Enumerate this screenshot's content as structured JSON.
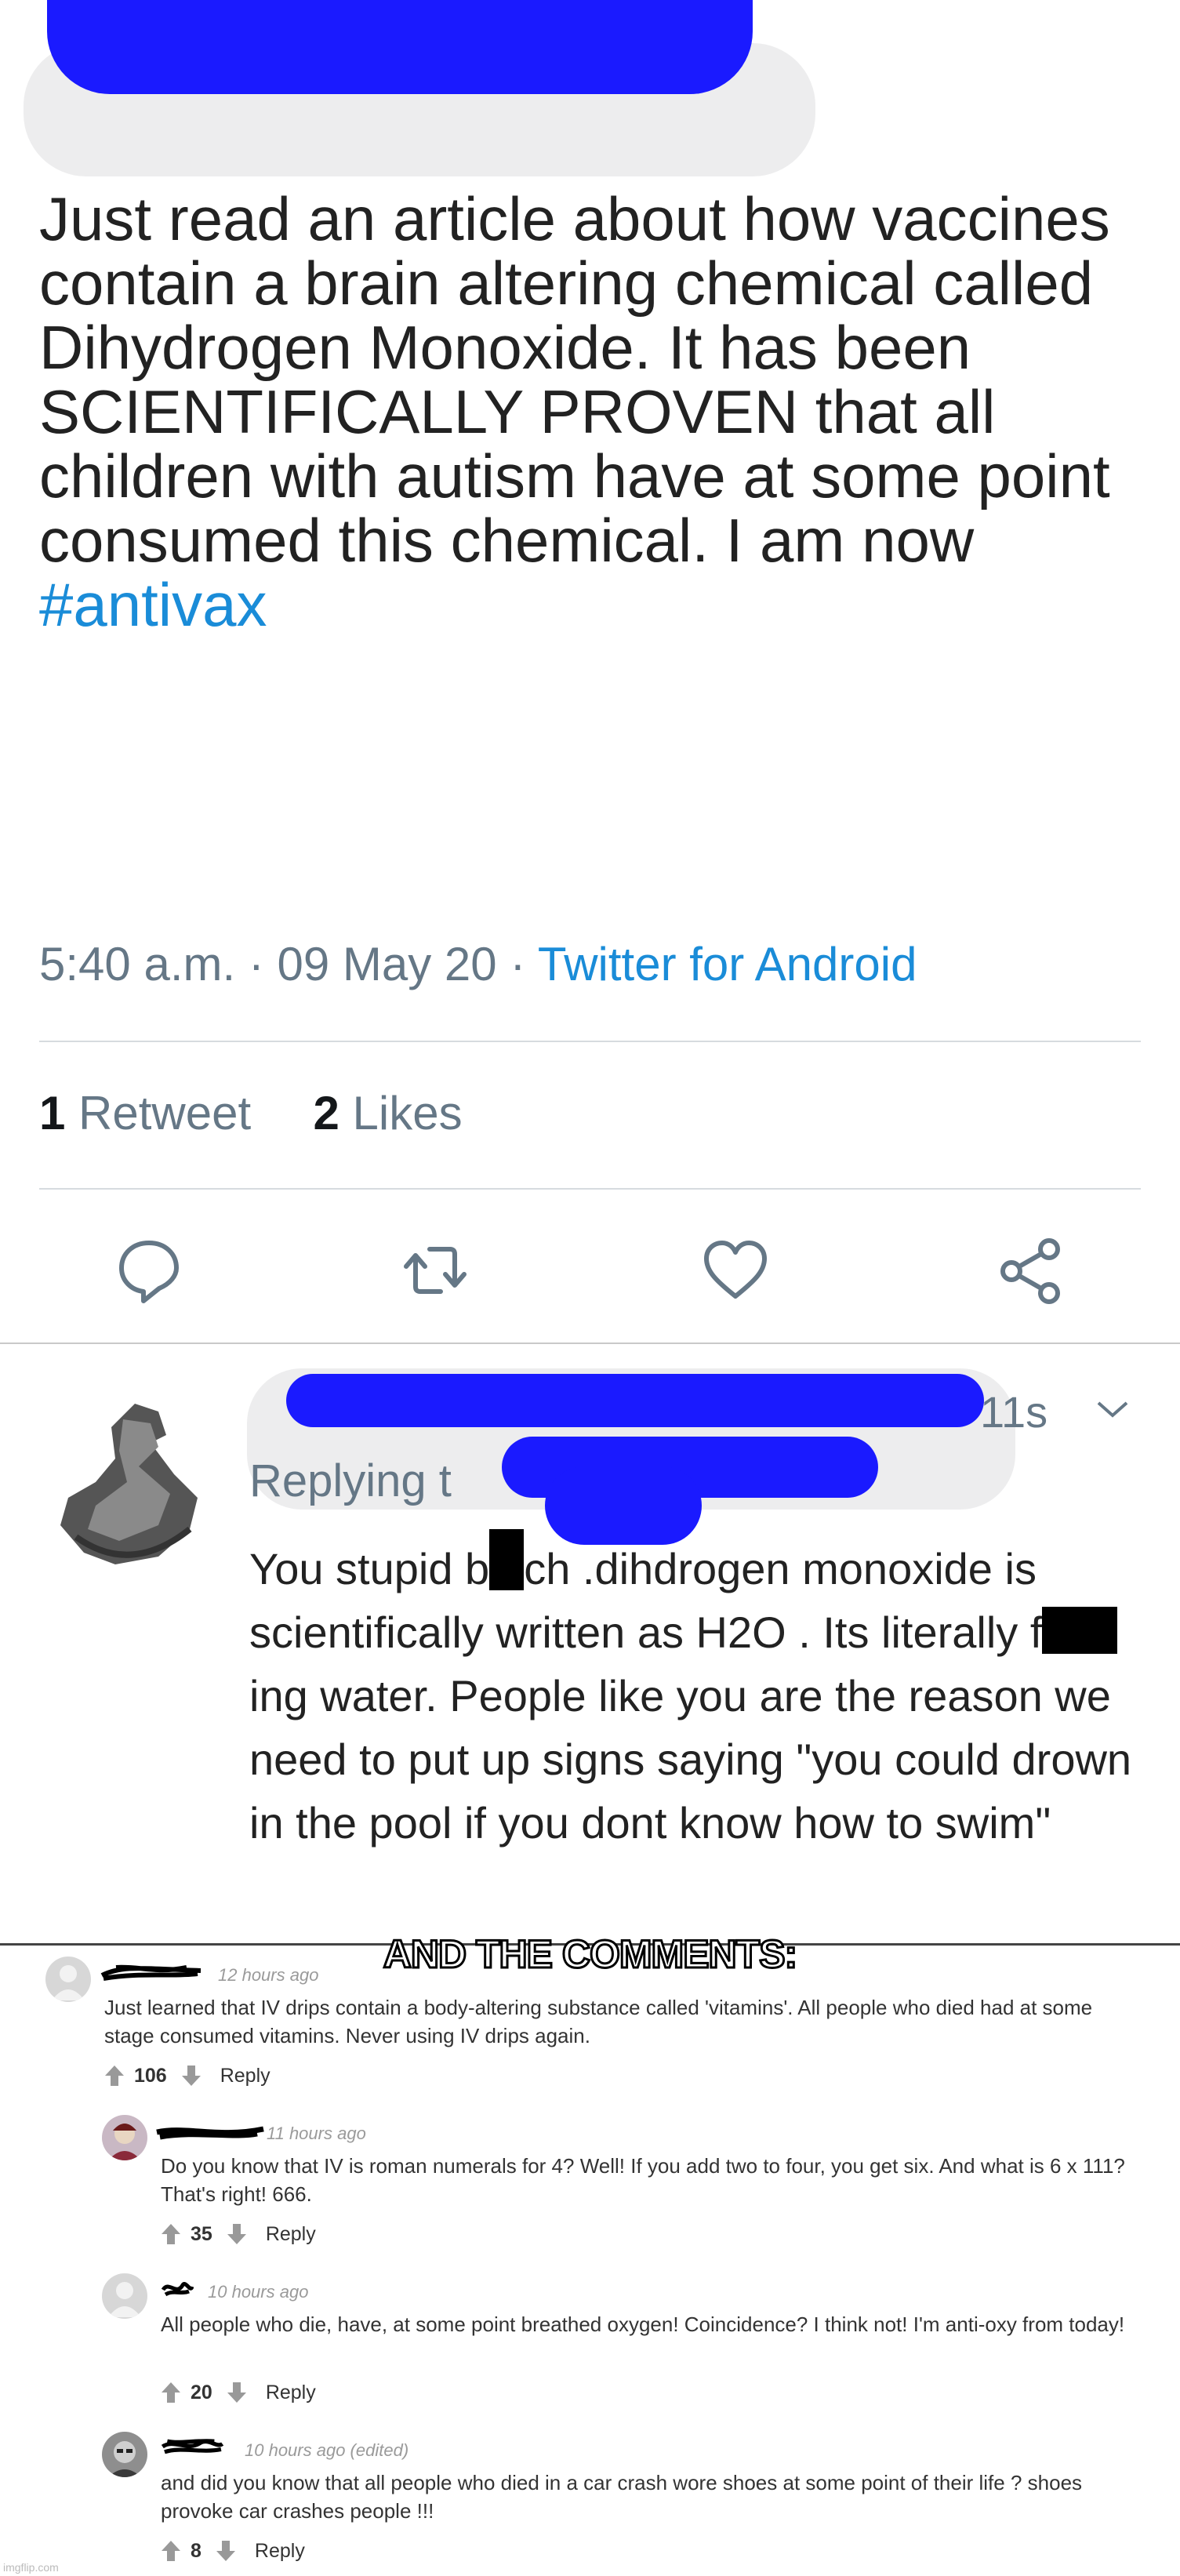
{
  "tweet": {
    "text": "Just read an article about how vaccines contain a brain altering chemical called Dihydrogen Monoxide. It has been SCIENTIFICALLY PROVEN that all children with autism have at some point consumed this chemical. I am now ",
    "hashtag": "#antivax",
    "time": "5:40 a.m.",
    "date": "09 May 20",
    "source": "Twitter for Android",
    "retweets_count": "1",
    "retweets_label": "Retweet",
    "likes_count": "2",
    "likes_label": "Likes",
    "actions": [
      "reply-icon",
      "retweet-icon",
      "like-icon",
      "share-icon"
    ]
  },
  "reply": {
    "time": "11s",
    "replying_to": "Replying t",
    "text_1": "You stupid b",
    "text_2": "ch .dihdrogen monoxide is scientifically written as H2O . Its literally f",
    "text_3": "ing water. People like you are the reason we need to put up signs saying \"you could drown in the pool if you dont know how to swim\""
  },
  "overlay_title": "AND THE COMMENTS:",
  "comments": [
    {
      "time": "12 hours ago",
      "text": "Just learned that IV drips contain a body-altering substance called 'vitamins'. All people who died had at some stage consumed vitamins. Never using IV drips again.",
      "votes": "106",
      "reply_label": "Reply"
    },
    {
      "time": "11 hours ago",
      "text": "Do you know that IV is roman numerals for 4? Well! If you add two to four, you get six. And what is 6 x 111? That's right! 666.",
      "votes": "35",
      "reply_label": "Reply"
    },
    {
      "time": "10 hours ago",
      "text": "All people who die, have, at some point breathed oxygen! Coincidence? I think not! I'm anti-oxy from today!",
      "votes": "20",
      "reply_label": "Reply"
    },
    {
      "time": "10 hours ago (edited)",
      "text": "and did you know that all people who died in a car crash wore shoes at some point of their life ? shoes provoke car crashes people !!!",
      "votes": "8",
      "reply_label": "Reply"
    }
  ],
  "watermark": "imgflip.com",
  "colors": {
    "link": "#1a8cd8",
    "scribble": "#1a1aff",
    "muted": "#657786"
  }
}
